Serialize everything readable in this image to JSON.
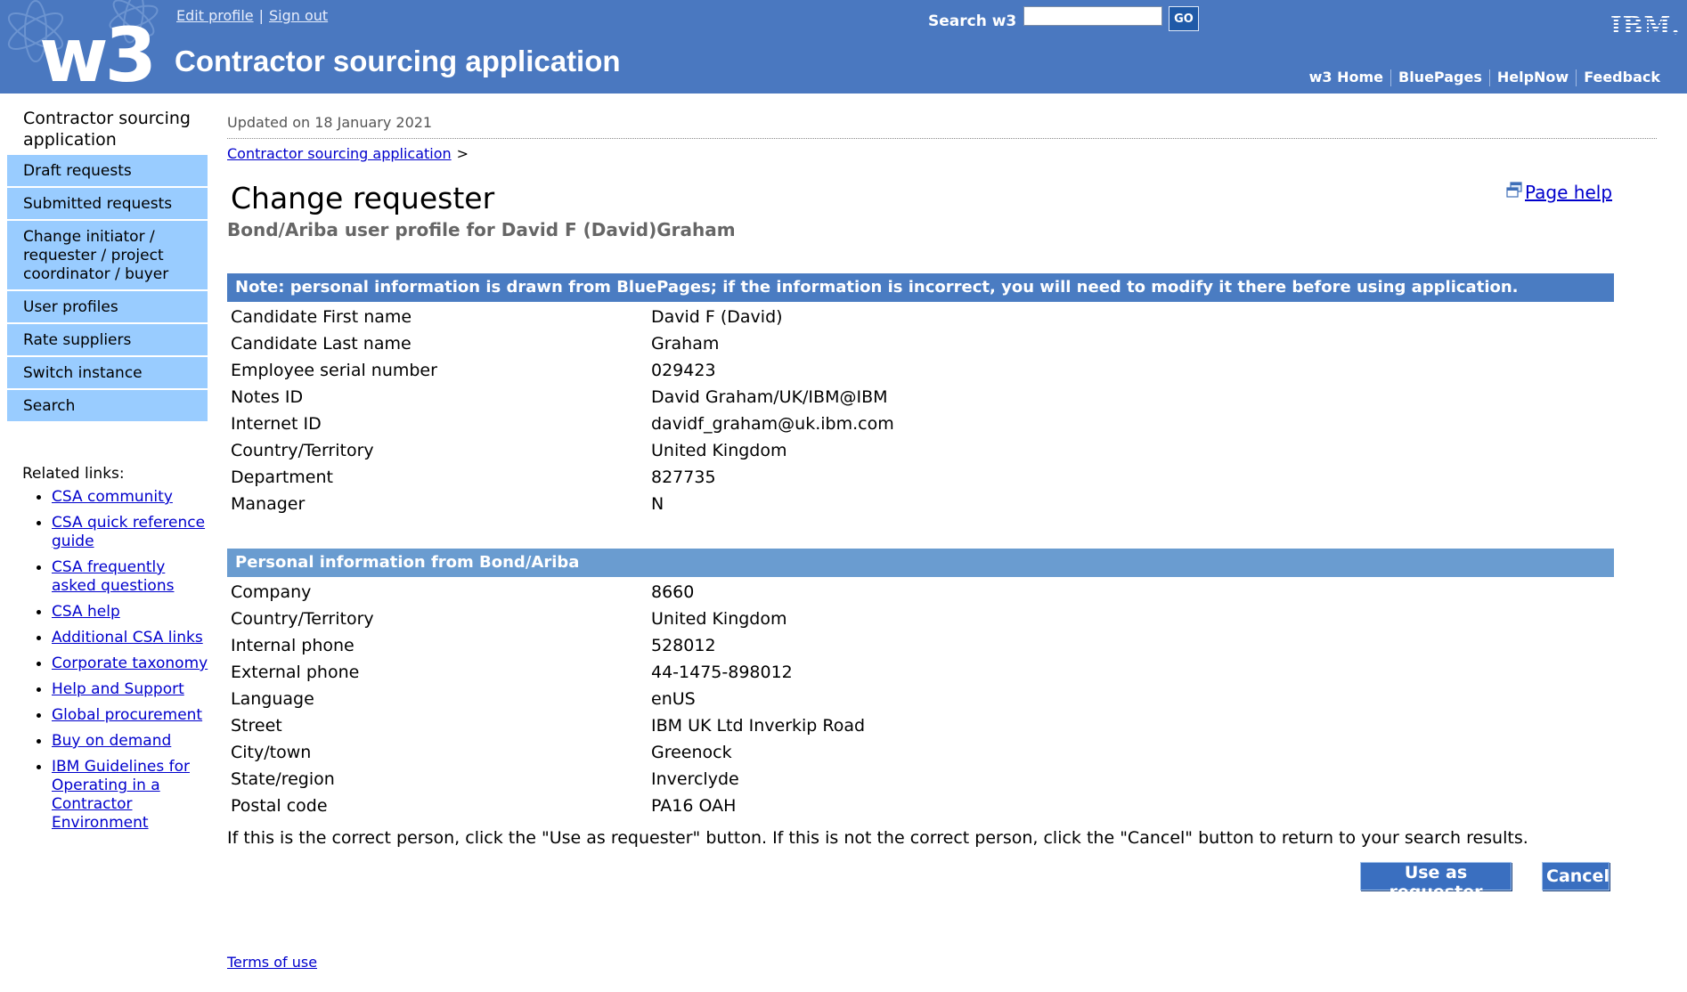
{
  "header": {
    "logo": "w3",
    "top_links": [
      "Edit profile",
      "Sign out"
    ],
    "app_title": "Contractor sourcing application",
    "search_label": "Search w3",
    "search_value": "",
    "go_label": "GO",
    "ibm_logo": "IBM.",
    "nav": [
      "w3 Home",
      "BluePages",
      "HelpNow",
      "Feedback"
    ],
    "colors": {
      "masthead": "#4a78c0",
      "nav_item": "#99ccff"
    }
  },
  "sidebar": {
    "title": "Contractor sourcing application",
    "items": [
      "Draft requests",
      "Submitted requests",
      "Change initiator / requester / project coordinator / buyer",
      "User profiles",
      "Rate suppliers",
      "Switch instance",
      "Search"
    ],
    "related_title": "Related links:",
    "related_links": [
      "CSA community",
      "CSA quick reference guide",
      "CSA frequently asked questions",
      "CSA help",
      "Additional CSA links",
      "Corporate taxonomy",
      "Help and Support",
      "Global procurement",
      "Buy on demand",
      "IBM Guidelines for Operating in a Contractor Environment"
    ]
  },
  "main": {
    "updated": "Updated on 18 January 2021",
    "breadcrumb": "Contractor sourcing application",
    "breadcrumb_arrow": ">",
    "title": "Change requester",
    "subtitle": "Bond/Ariba user profile for David F (David)Graham",
    "page_help": "Page help",
    "note": "Note: personal information is drawn from BluePages; if the information is incorrect, you will need to modify it there before using application.",
    "bluepages_rows": [
      {
        "label": "Candidate First name",
        "value": "David F (David)"
      },
      {
        "label": "Candidate Last name",
        "value": "Graham"
      },
      {
        "label": "Employee serial number",
        "value": "029423"
      },
      {
        "label": "Notes ID",
        "value": "David Graham/UK/IBM@IBM"
      },
      {
        "label": "Internet ID",
        "value": "davidf_graham@uk.ibm.com"
      },
      {
        "label": "Country/Territory",
        "value": "United Kingdom"
      },
      {
        "label": "Department",
        "value": "827735"
      },
      {
        "label": "Manager",
        "value": "N"
      }
    ],
    "bond_heading": "Personal information from Bond/Ariba",
    "bond_rows": [
      {
        "label": "Company",
        "value": "8660"
      },
      {
        "label": "Country/Territory",
        "value": "United Kingdom"
      },
      {
        "label": "Internal phone",
        "value": "528012"
      },
      {
        "label": "External phone",
        "value": "44-1475-898012"
      },
      {
        "label": "Language",
        "value": "enUS"
      },
      {
        "label": "Street",
        "value": "IBM UK Ltd Inverkip Road"
      },
      {
        "label": "City/town",
        "value": "Greenock"
      },
      {
        "label": "State/region",
        "value": "Inverclyde"
      },
      {
        "label": "Postal code",
        "value": "PA16 OAH"
      }
    ],
    "instruction": "If this is the correct person, click the \"Use as requester\" button. If this is not the correct person, click the \"Cancel\" button to return to your search results.",
    "use_button": "Use as requester",
    "cancel_button": "Cancel",
    "terms": "Terms of use"
  }
}
